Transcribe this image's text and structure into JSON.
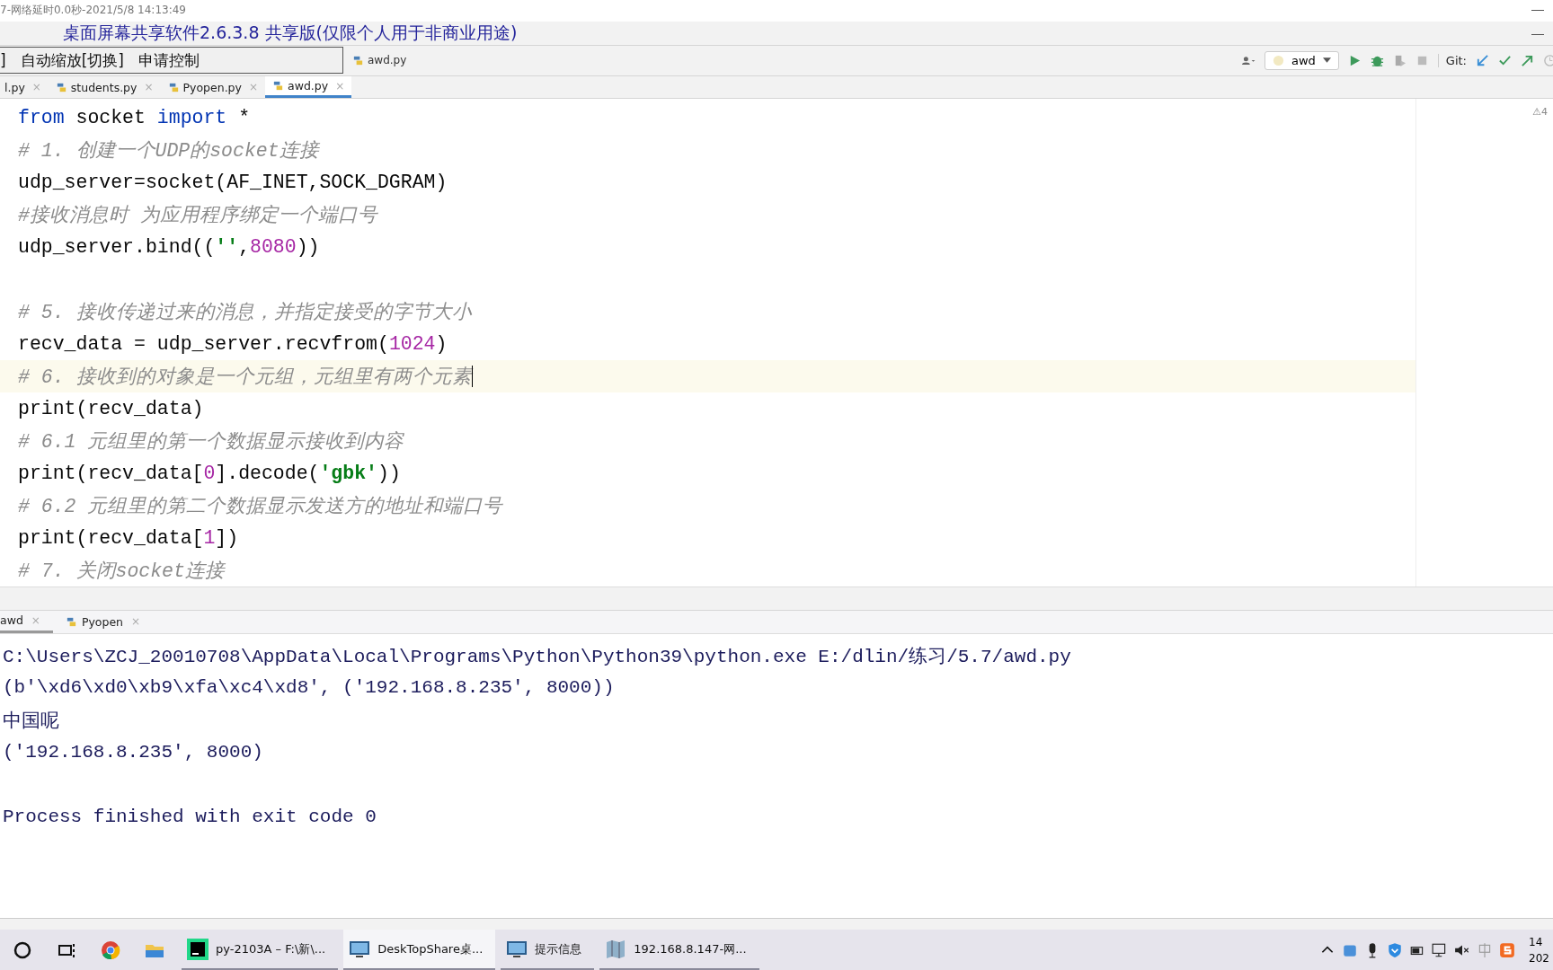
{
  "remote_bar": {
    "status": "7-网络延时0.0秒-2021/5/8 14:13:49",
    "title": "桌面屏幕共享软件2.6.3.8 共享版(仅限个人用于非商业用途)"
  },
  "remote_menu": {
    "items": [
      "]",
      "自动缩放[切换]",
      "申请控制"
    ]
  },
  "breadcrumb": {
    "file": "awd.py"
  },
  "toolbar": {
    "run_config": "awd",
    "git_label": "Git:"
  },
  "editor_tabs": [
    {
      "label": "l.py",
      "close": "×",
      "selected": false
    },
    {
      "label": "students.py",
      "close": "×",
      "selected": false
    },
    {
      "label": "Pyopen.py",
      "close": "×",
      "selected": false
    },
    {
      "label": "awd.py",
      "close": "×",
      "selected": true
    }
  ],
  "warnings": "⚠4",
  "code_lines": [
    {
      "kind": "code",
      "current": false,
      "tokens": [
        {
          "kind": "keyword",
          "text": "from"
        },
        {
          "kind": "plain",
          "text": " socket "
        },
        {
          "kind": "keyword",
          "text": "import"
        },
        {
          "kind": "plain",
          "text": " *"
        }
      ]
    },
    {
      "kind": "code",
      "current": false,
      "tokens": [
        {
          "kind": "comment",
          "text": "# 1. 创建一个UDP的socket连接"
        }
      ]
    },
    {
      "kind": "code",
      "current": false,
      "tokens": [
        {
          "kind": "plain",
          "text": "udp_server=socket(AF_INET,SOCK_DGRAM)"
        }
      ]
    },
    {
      "kind": "code",
      "current": false,
      "tokens": [
        {
          "kind": "comment",
          "text": "#接收消息时 为应用程序绑定一个端口号"
        }
      ]
    },
    {
      "kind": "code",
      "current": false,
      "tokens": [
        {
          "kind": "plain",
          "text": "udp_server.bind(("
        },
        {
          "kind": "string",
          "text": "''"
        },
        {
          "kind": "plain",
          "text": ","
        },
        {
          "kind": "number",
          "text": "8080"
        },
        {
          "kind": "plain",
          "text": "))"
        }
      ]
    },
    {
      "kind": "blank"
    },
    {
      "kind": "code",
      "current": false,
      "tokens": [
        {
          "kind": "comment",
          "text": "# 5. 接收传递过来的消息，并指定接受的字节大小"
        }
      ]
    },
    {
      "kind": "code",
      "current": false,
      "tokens": [
        {
          "kind": "plain",
          "text": "recv_data = udp_server.recvfrom("
        },
        {
          "kind": "number",
          "text": "1024"
        },
        {
          "kind": "plain",
          "text": ")"
        }
      ]
    },
    {
      "kind": "code",
      "current": true,
      "tokens": [
        {
          "kind": "comment",
          "text": "# 6. 接收到的对象是一个元组，元组里有两个元素"
        }
      ]
    },
    {
      "kind": "code",
      "current": false,
      "tokens": [
        {
          "kind": "plain",
          "text": "print(recv_data)"
        }
      ]
    },
    {
      "kind": "code",
      "current": false,
      "tokens": [
        {
          "kind": "comment",
          "text": "# 6.1 元组里的第一个数据显示接收到内容"
        }
      ]
    },
    {
      "kind": "code",
      "current": false,
      "tokens": [
        {
          "kind": "plain",
          "text": "print(recv_data["
        },
        {
          "kind": "number",
          "text": "0"
        },
        {
          "kind": "plain",
          "text": "].decode("
        },
        {
          "kind": "string",
          "text": "'gbk'"
        },
        {
          "kind": "plain",
          "text": "))"
        }
      ]
    },
    {
      "kind": "code",
      "current": false,
      "tokens": [
        {
          "kind": "comment",
          "text": "# 6.2 元组里的第二个数据显示发送方的地址和端口号"
        }
      ]
    },
    {
      "kind": "code",
      "current": false,
      "tokens": [
        {
          "kind": "plain",
          "text": "print(recv_data["
        },
        {
          "kind": "number",
          "text": "1"
        },
        {
          "kind": "plain",
          "text": "])"
        }
      ]
    },
    {
      "kind": "code",
      "current": false,
      "tokens": [
        {
          "kind": "comment",
          "text": "# 7. 关闭socket连接"
        }
      ]
    }
  ],
  "run_tabs": [
    {
      "label": "awd",
      "close": "×",
      "selected": true
    },
    {
      "label": "Pyopen",
      "close": "×",
      "selected": false
    }
  ],
  "console_lines": [
    {
      "kind": "output",
      "text": "C:\\Users\\ZCJ_20010708\\AppData\\Local\\Programs\\Python\\Python39\\python.exe E:/dlin/练习/5.7/awd.py"
    },
    {
      "kind": "output",
      "text": "(b'\\xd6\\xd0\\xb9\\xfa\\xc4\\xd8', ('192.168.8.235', 8000))"
    },
    {
      "kind": "output",
      "text": "中国呢"
    },
    {
      "kind": "output",
      "text": "('192.168.8.235', 8000)"
    },
    {
      "kind": "blank"
    },
    {
      "kind": "output",
      "text": "Process finished with exit code 0"
    }
  ],
  "taskbar": {
    "apps": [
      {
        "kind": "pycharm",
        "label": "py-2103A – F:\\新\\...",
        "selected": false
      },
      {
        "kind": "monitor",
        "label": "DeskTopShare桌...",
        "selected": true
      },
      {
        "kind": "monitor",
        "label": "提示信息",
        "selected": false
      },
      {
        "kind": "map",
        "label": "192.168.8.147-网...",
        "selected": false
      }
    ],
    "clock": [
      "14",
      "202"
    ]
  }
}
